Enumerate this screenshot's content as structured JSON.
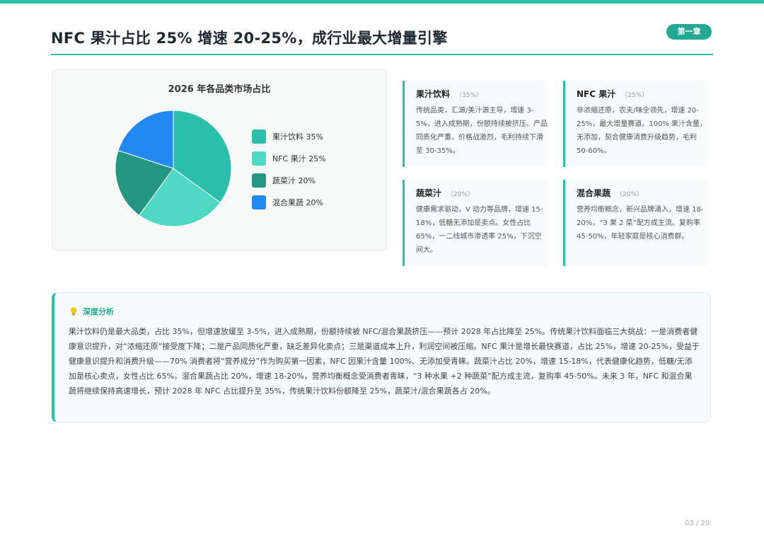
{
  "header": {
    "title": "NFC 果汁占比 25% 增速 20-25%，成行业最大增量引擎",
    "chapter_badge": "第一章"
  },
  "chart_data": {
    "type": "pie",
    "title": "2026 年各品类市场占比",
    "categories": [
      "果汁饮料",
      "NFC 果汁",
      "蔬菜汁",
      "混合果蔬"
    ],
    "values": [
      35,
      25,
      20,
      20
    ],
    "colors": [
      "#2bbfaa",
      "#4fd8c4",
      "#249684",
      "#2289f2"
    ],
    "legend_labels": [
      "果汁饮料 35%",
      "NFC 果汁 25%",
      "蔬菜汁 20%",
      "混合果蔬 20%"
    ],
    "legend_position": "right"
  },
  "cards": [
    {
      "title": "果汁饮料",
      "pct": "（35%）",
      "body": "传统品类，汇源/美汁源主导，增速 3-5%，进入成熟期，份额持续被挤压。产品同质化严重，价格战激烈，毛利持续下滑至 30-35%。"
    },
    {
      "title": "NFC 果汁",
      "pct": "（25%）",
      "body": "非浓缩还原，农夫/味全领先，增速 20-25%，最大增量赛道。100% 果汁含量，无添加，契合健康消费升级趋势，毛利 50-60%。"
    },
    {
      "title": "蔬菜汁",
      "pct": "（20%）",
      "body": "健康需求驱动，V 动力等品牌，增速 15-18%，低糖无添加是卖点。女性占比 65%，一二线城市渗透率 25%，下沉空间大。"
    },
    {
      "title": "混合果蔬",
      "pct": "（20%）",
      "body": "营养均衡概念，新兴品牌涌入，增速 18-20%，“3 果 2 菜”配方成主流。复购率 45-50%，年轻家庭是核心消费群。"
    }
  ],
  "analysis": {
    "icon": "bulb-icon",
    "title": "深度分析",
    "body": "果汁饮料仍是最大品类，占比 35%，但增速放缓至 3-5%，进入成熟期，份额持续被 NFC/混合果蔬挤压——预计 2028 年占比降至 25%。传统果汁饮料面临三大挑战：一是消费者健康意识提升，对“浓缩还原”接受度下降；二是产品同质化严重，缺乏差异化卖点；三是渠道成本上升，利润空间被压缩。NFC 果汁是增长最快赛道，占比 25%，增速 20-25%，受益于健康意识提升和消费升级——70% 消费者将“营养成分”作为购买第一因素，NFC 因果汁含量 100%、无添加受青睐。蔬菜汁占比 20%，增速 15-18%，代表健康化趋势，低糖/无添加是核心卖点，女性占比 65%。混合果蔬占比 20%，增速 18-20%，营养均衡概念受消费者青睐，“3 种水果 +2 种蔬菜”配方成主流，复购率 45-50%。未来 3 年，NFC 和混合果蔬将继续保持高速增长，预计 2028 年 NFC 占比提升至 35%，传统果汁饮料份额降至 25%，蔬菜汁/混合果蔬各占 20%。"
  },
  "footer": {
    "page": "03 / 20"
  }
}
